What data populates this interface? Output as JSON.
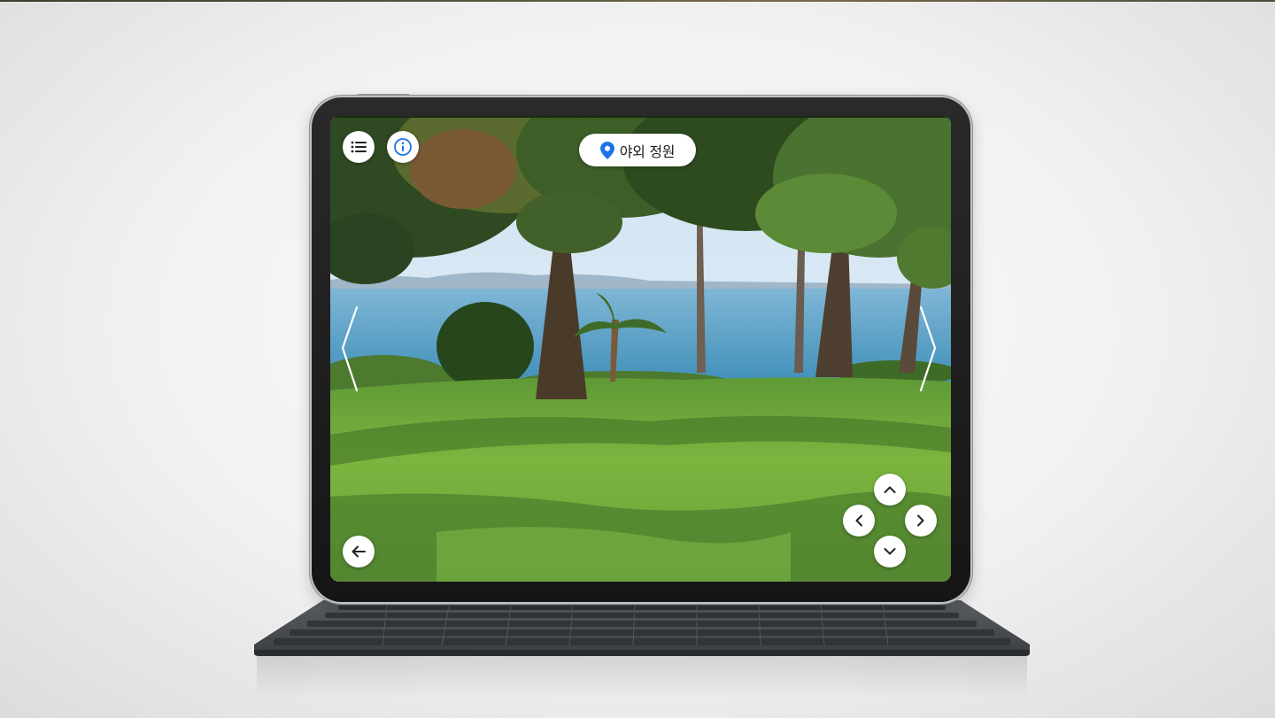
{
  "scene": {
    "location_label": "야외 정원"
  },
  "icons": {
    "menu": "list-icon",
    "info": "info-icon",
    "location": "map-pin-icon",
    "prev": "chevron-left-thin-icon",
    "next": "chevron-right-thin-icon",
    "back": "arrow-left-icon",
    "pan_up": "chevron-up-icon",
    "pan_down": "chevron-down-icon",
    "pan_left": "chevron-left-icon",
    "pan_right": "chevron-right-icon"
  },
  "colors": {
    "accent_blue": "#1a73e8",
    "button_bg": "#ffffff",
    "device_bezel": "#151515",
    "keyboard": "#4a4d52"
  }
}
